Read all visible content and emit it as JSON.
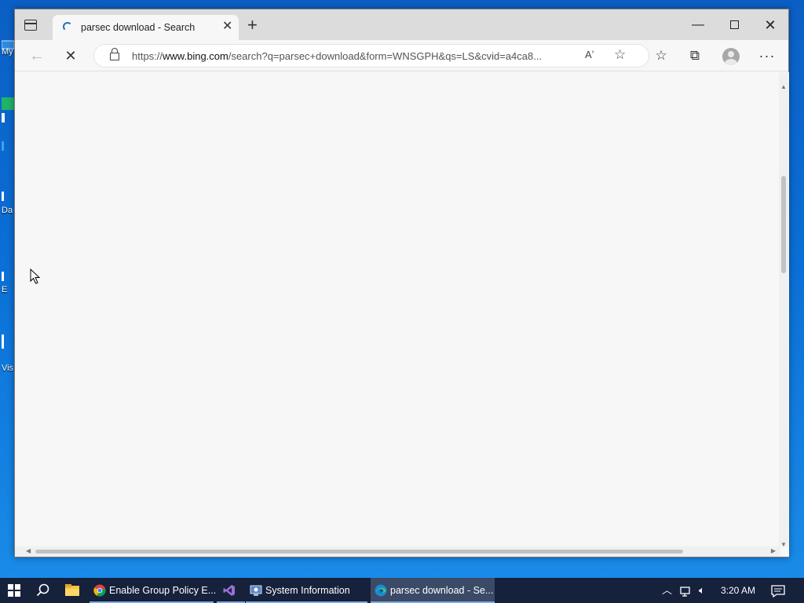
{
  "desktop": {
    "icons": [
      {
        "label": "My"
      },
      {
        "label": "Da"
      },
      {
        "label": "E"
      },
      {
        "label": "Vis"
      }
    ]
  },
  "browser": {
    "tab": {
      "title": "parsec download - Search"
    },
    "address": {
      "url_prefix": "https://",
      "url_host": "www.bing.com",
      "url_path": "/search?q=parsec+download&form=WNSGPH&qs=LS&cvid=a4ca8..."
    },
    "icons": {
      "tab_actions": "tab-actions-icon",
      "close_tab": "close-icon",
      "new_tab": "plus-icon",
      "minimize": "minimize-icon",
      "maximize": "maximize-icon",
      "close_window": "close-icon",
      "back": "back-arrow-icon",
      "stop": "stop-icon",
      "lock": "lock-icon",
      "read_aloud": "read-aloud-icon",
      "add_favorite": "star-plus-icon",
      "favorites": "favorites-icon",
      "collections": "collections-icon",
      "profile": "profile-icon",
      "more": "more-icon"
    },
    "read_aloud_text": "Aʼ"
  },
  "taskbar": {
    "apps": [
      {
        "label": "Enable Group Policy E...",
        "icon": "chrome-icon"
      },
      {
        "label": "",
        "icon": "visual-studio-icon"
      },
      {
        "label": "System Information",
        "icon": "system-information-icon"
      },
      {
        "label": "parsec download - Se...",
        "icon": "edge-icon",
        "active": true
      }
    ],
    "clock": "3:20 AM"
  },
  "colors": {
    "desktop_blue": "#0a63c9",
    "taskbar": "#16213c",
    "browser_bg": "#f7f7f7"
  }
}
